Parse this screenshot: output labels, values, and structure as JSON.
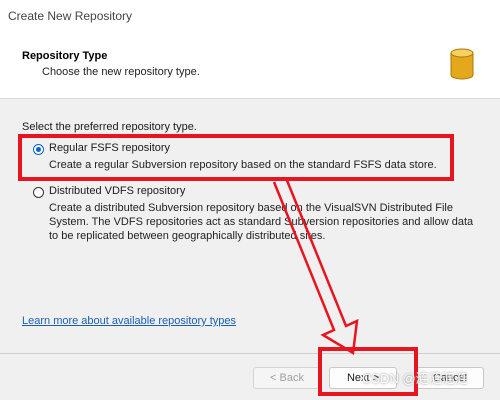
{
  "window": {
    "title": "Create New Repository"
  },
  "header": {
    "title": "Repository Type",
    "subtitle": "Choose the new repository type.",
    "icon": "database-icon"
  },
  "main": {
    "prompt": "Select the preferred repository type.",
    "options": [
      {
        "label": "Regular FSFS repository",
        "selected": true,
        "description": [
          "Create a regular Subversion repository based on the standard FSFS data store."
        ]
      },
      {
        "label": "Distributed VDFS repository",
        "selected": false,
        "description": [
          "Create a distributed Subversion repository based on the VisualSVN Distributed File",
          "System. The VDFS repositories act as standard Subversion repositories and allow data",
          "to be replicated between geographically distributed sites."
        ]
      }
    ],
    "link": "Learn more about available repository types"
  },
  "footer": {
    "back_label": "< Back",
    "next_label": "Next >",
    "cancel_label": "Cancel"
  },
  "watermark": "CSDN @涟涟涟涟",
  "colors": {
    "annotation": "#e8141f",
    "accent": "#0a64c8",
    "link": "#1a5fb4"
  }
}
